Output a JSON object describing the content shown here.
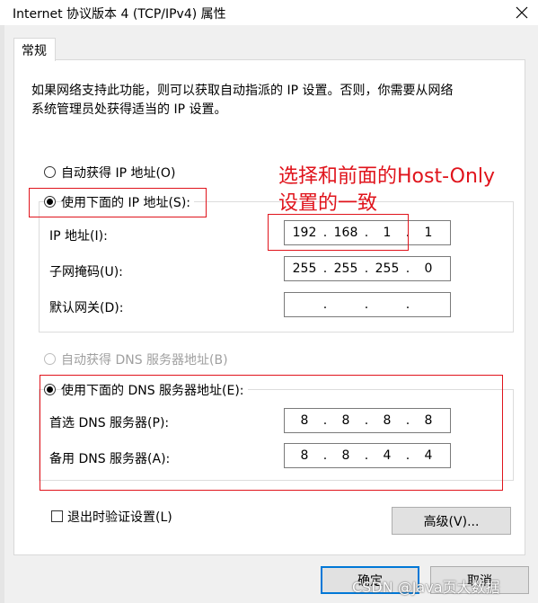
{
  "window": {
    "title": "Internet 协议版本 4 (TCP/IPv4) 属性"
  },
  "tab": {
    "label": "常规"
  },
  "description": {
    "line1": "如果网络支持此功能，则可以获取自动指派的 IP 设置。否则，你需要从网络",
    "line2": "系统管理员处获得适当的 IP 设置。"
  },
  "ip_section": {
    "auto_label": "自动获得 IP 地址(O)",
    "auto_selected": false,
    "manual_label": "使用下面的 IP 地址(S):",
    "manual_selected": true,
    "ip_label": "IP 地址(I):",
    "ip_octets": [
      "192",
      "168",
      "1",
      "1"
    ],
    "mask_label": "子网掩码(U):",
    "mask_octets": [
      "255",
      "255",
      "255",
      "0"
    ],
    "gateway_label": "默认网关(D):",
    "gateway_octets": [
      "",
      "",
      "",
      ""
    ]
  },
  "dns_section": {
    "auto_label": "自动获得 DNS 服务器地址(B)",
    "auto_selected": false,
    "manual_label": "使用下面的 DNS 服务器地址(E):",
    "manual_selected": true,
    "preferred_label": "首选 DNS 服务器(P):",
    "preferred_octets": [
      "8",
      "8",
      "8",
      "8"
    ],
    "alternate_label": "备用 DNS 服务器(A):",
    "alternate_octets": [
      "8",
      "8",
      "4",
      "4"
    ]
  },
  "validate_label": "退出时验证设置(L)",
  "validate_checked": false,
  "buttons": {
    "advanced": "高级(V)...",
    "ok": "确定",
    "cancel": "取消"
  },
  "annotation": {
    "line1": "选择和前面的Host-Only",
    "line2": "设置的一致"
  },
  "watermark": "CSDN @Java页大数据",
  "colors": {
    "annotation": "#e0141c",
    "focus_border": "#0078d7"
  }
}
